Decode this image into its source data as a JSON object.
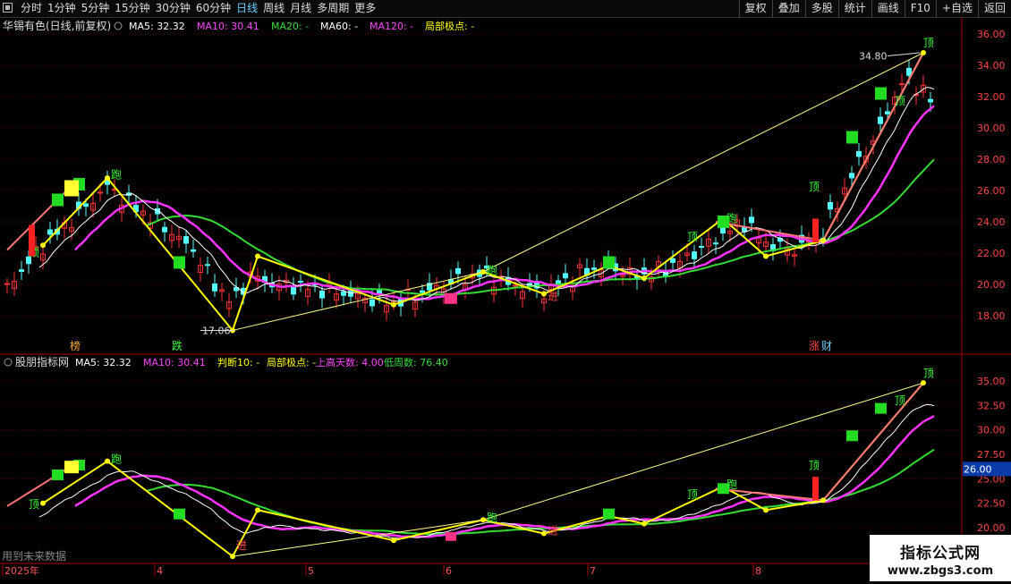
{
  "toolbar": {
    "periods": [
      "分时",
      "1分钟",
      "5分钟",
      "15分钟",
      "30分钟",
      "60分钟",
      "日线",
      "周线",
      "月线",
      "多周期",
      "更多"
    ],
    "active": "日线",
    "buttons": [
      "复权",
      "叠加",
      "多股",
      "统计",
      "画线",
      "F10",
      "+自选",
      "返回"
    ]
  },
  "main": {
    "title": "华锡有色(日线,前复权)",
    "indicators": [
      {
        "label": "MA5: 32.32",
        "color": "#ffffff"
      },
      {
        "label": "MA10: 30.41",
        "color": "#ff44ff"
      },
      {
        "label": "MA20: -",
        "color": "#33dd33"
      },
      {
        "label": "MA60: -",
        "color": "#ffffff"
      },
      {
        "label": "MA120: -",
        "color": "#ff44ff"
      },
      {
        "label": "局部极点: -",
        "color": "#ffff00"
      }
    ],
    "price_ticks": [
      "36.00",
      "34.00",
      "32.00",
      "30.00",
      "28.00",
      "26.00",
      "24.00",
      "22.00",
      "20.00",
      "18.00"
    ],
    "annotations": {
      "high": "34.80",
      "low": "17.06"
    },
    "markers": {
      "run": "跑",
      "top": "顶",
      "enter": "进"
    },
    "bottom_labels": [
      "榜",
      "跌",
      "涨",
      "财"
    ]
  },
  "sub": {
    "title": "股朋指标网",
    "indicators": [
      {
        "label": "MA5: 32.32",
        "color": "#ffffff"
      },
      {
        "label": "MA10: 30.41",
        "color": "#ff44ff"
      },
      {
        "label": "判断10: -",
        "color": "#ffff00"
      },
      {
        "label": "局部极点: -",
        "color": "#ffff00"
      },
      {
        "label": "上高天数: 4.00",
        "color": "#ff44ff"
      },
      {
        "label": "低周数: 76.40",
        "color": "#33dd33"
      }
    ],
    "ticks": [
      "35.00",
      "32.50",
      "30.00",
      "27.50",
      "25.00",
      "22.50",
      "20.00"
    ],
    "current_value": "26.00",
    "note": "用到未来数据"
  },
  "xaxis": {
    "labels": [
      "2025年",
      "4",
      "5",
      "6",
      "7",
      "8"
    ]
  },
  "watermark": {
    "line1": "指标公式网",
    "line2": "www.zbgs3.com"
  },
  "colors": {
    "up": "#ff3333",
    "down": "#54ffff",
    "ma5": "#ffffff",
    "ma10": "#ff33ff",
    "ma20": "#33dd33",
    "pole": "#ffff00",
    "trend": "#ff7777",
    "grid": "#5a0000"
  }
}
